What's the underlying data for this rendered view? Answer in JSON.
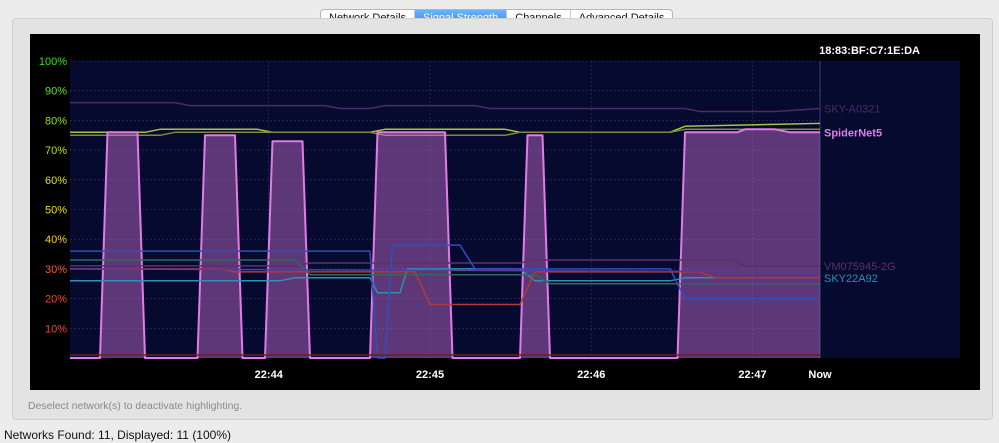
{
  "tabs": [
    {
      "label": "Network Details",
      "active": false
    },
    {
      "label": "Signal Strength",
      "active": true
    },
    {
      "label": "Channels",
      "active": false
    },
    {
      "label": "Advanced Details",
      "active": false
    }
  ],
  "hint": "Deselect network(s) to deactivate highlighting.",
  "status": "Networks Found: 11, Displayed: 11 (100%)",
  "chart_data": {
    "type": "line",
    "title": "18:83:BF:C7:1E:DA",
    "x_ticks": [
      "22:44",
      "22:45",
      "22:46",
      "22:47",
      "Now"
    ],
    "y_ticks": [
      "10%",
      "20%",
      "30%",
      "40%",
      "50%",
      "60%",
      "70%",
      "80%",
      "90%",
      "100%"
    ],
    "ylim": [
      0,
      100
    ],
    "xlim": [
      0,
      100
    ],
    "grid": true,
    "series": [
      {
        "name": "SKY-A0321",
        "color": "#4a2a6b",
        "x": [
          0,
          14,
          16,
          34,
          36,
          40,
          42,
          54,
          56,
          68,
          70,
          82,
          84,
          94,
          100
        ],
        "values": [
          86,
          86,
          85,
          85,
          84,
          84,
          85,
          85,
          84,
          84,
          84,
          84,
          83,
          83,
          84
        ]
      },
      {
        "name": "",
        "color": "#a9c23f",
        "x": [
          0,
          10,
          12,
          25,
          27,
          40,
          42,
          58,
          60,
          80,
          82,
          100
        ],
        "values": [
          76,
          76,
          77,
          77,
          76,
          76,
          77,
          77,
          76,
          76,
          78,
          79
        ]
      },
      {
        "name": "",
        "color": "#7f8a3a",
        "x": [
          0,
          12,
          14,
          40,
          42,
          58,
          60,
          80,
          82,
          100
        ],
        "values": [
          75,
          75,
          76,
          76,
          75,
          75,
          76,
          76,
          77,
          77
        ]
      },
      {
        "name": "SpiderNet5",
        "color": "#e27be6",
        "highlighted": true,
        "x": [
          0,
          4,
          5,
          9,
          10,
          17,
          18,
          22,
          23,
          26,
          27,
          31,
          32,
          40,
          41,
          50,
          51,
          60,
          61,
          63,
          64,
          81,
          82,
          89,
          90,
          94,
          96,
          100
        ],
        "values": [
          0,
          0,
          76,
          76,
          0,
          0,
          75,
          75,
          0,
          0,
          73,
          73,
          0,
          0,
          76,
          76,
          0,
          0,
          75,
          75,
          0,
          0,
          76,
          76,
          77,
          77,
          76,
          76
        ]
      },
      {
        "name": "VM075945-2G",
        "color": "#5f2f6e",
        "x": [
          0,
          30,
          32,
          60,
          62,
          88,
          90,
          100
        ],
        "values": [
          31,
          31,
          32,
          32,
          33,
          33,
          31,
          31
        ]
      },
      {
        "name": "SKY22A92",
        "color": "#2f8fb5",
        "x": [
          0,
          28,
          30,
          40,
          41,
          44,
          45,
          60,
          62,
          80,
          82,
          100
        ],
        "values": [
          26,
          26,
          27,
          27,
          22,
          22,
          30,
          30,
          26,
          26,
          27,
          27
        ]
      },
      {
        "name": "",
        "color": "#b03a3a",
        "x": [
          0,
          20,
          22,
          46,
          48,
          60,
          62,
          84,
          86,
          100
        ],
        "values": [
          30,
          30,
          29,
          29,
          18,
          18,
          29,
          29,
          27,
          27
        ]
      },
      {
        "name": "",
        "color": "#2f4fc0",
        "x": [
          0,
          40,
          41,
          42,
          43,
          52,
          54,
          80,
          82,
          100
        ],
        "values": [
          36,
          36,
          0,
          0,
          38,
          38,
          30,
          30,
          20,
          20
        ]
      },
      {
        "name": "",
        "color": "#2e6a5a",
        "x": [
          0,
          30,
          32,
          62,
          64,
          100
        ],
        "values": [
          33,
          33,
          28,
          28,
          25,
          25
        ]
      },
      {
        "name": "",
        "color": "#5a3a9a",
        "x": [
          0,
          100
        ],
        "values": [
          30,
          29
        ]
      },
      {
        "name": "",
        "color": "#6a2020",
        "x": [
          0,
          100
        ],
        "values": [
          1,
          1
        ]
      }
    ]
  },
  "colors": {
    "plot_bg": "#050a2e",
    "grid": "#2a3a6a",
    "tick_colors": [
      "#ff3b2a",
      "#ff3b2a",
      "#ff5a1a",
      "#ffd000",
      "#f2e600",
      "#d9e800",
      "#b9ea00",
      "#8ae800",
      "#5ee800",
      "#2fe800"
    ]
  }
}
